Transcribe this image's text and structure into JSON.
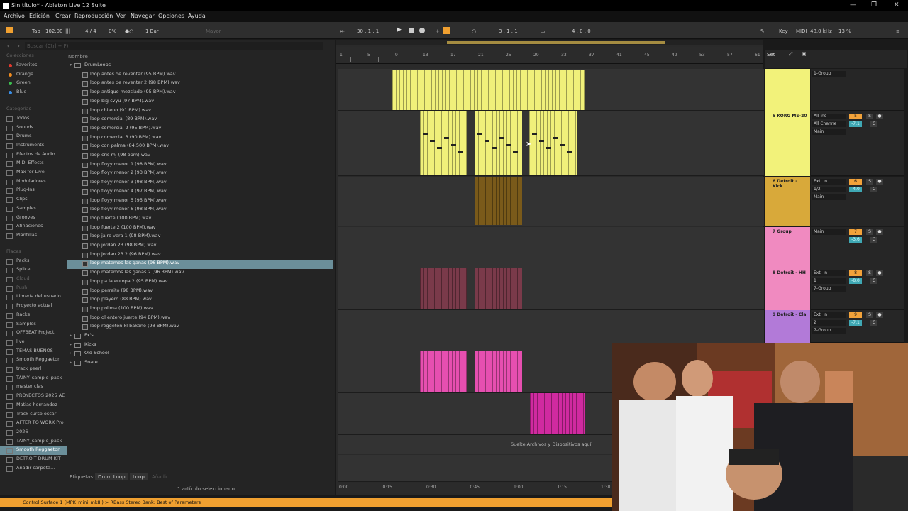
{
  "window": {
    "title": "Sin título* - Ableton Live 12 Suite"
  },
  "menu": [
    "Archivo",
    "Edición",
    "Crear",
    "Reproducción",
    "Ver",
    "Navegar",
    "Opciones",
    "Ayuda"
  ],
  "transport": {
    "tap": "Tap",
    "tempo": "102.00",
    "signature": "4 / 4",
    "percent": "0%",
    "quantize": "1 Bar",
    "key_text": "Mayor",
    "position": "30 .  1 .  1",
    "loop_start": "3 .  1 .  1",
    "loop_len": "4 .  0 .  0",
    "key_label": "Key",
    "midi_label": "MIDI",
    "sample_rate": "48.0 kHz",
    "cpu": "13 %"
  },
  "browser": {
    "search_placeholder": "Buscar (Ctrl + F)",
    "column_header": "Nombre",
    "collections_header": "Colecciones",
    "collections": [
      {
        "label": "Favoritos",
        "color": "#e23a2e"
      },
      {
        "label": "Orange",
        "color": "#f08b1f"
      },
      {
        "label": "Green",
        "color": "#3cbf4f"
      },
      {
        "label": "Blue",
        "color": "#3a8ee6"
      }
    ],
    "categories_header": "Categorías",
    "categories": [
      "Todos",
      "Sounds",
      "Drums",
      "Instruments",
      "Efectos de Audio",
      "MIDI Effects",
      "Max for Live",
      "Moduladores",
      "Plug-Ins",
      "Clips",
      "Samples",
      "Grooves",
      "Afinaciones",
      "Plantillas"
    ],
    "places_header": "Places",
    "places": [
      "Packs",
      "Splice",
      "Cloud",
      "Push",
      "Librería del usuario",
      "Proyecto actual",
      "Racks",
      "Samples",
      "OFFBEAT Project",
      "live",
      "TEMAS BUENOS",
      "Smooth Reggaeton",
      "track peerl",
      "TAINY_sample_pack",
      "master clas",
      "PROYECTOS 2025 AE",
      "Matias hernandez",
      "Track curso oscar",
      "AFTER TO WORK Pro",
      "2026",
      "TAINY_sample_pack",
      "Smooth Reggaeton",
      "DETROIT DRUM KIT",
      "Añadir carpeta..."
    ],
    "folder": "DrumLoops",
    "files": [
      "loop antes de reventar (95 BPM).wav",
      "loop antes de reventar 2 (98 BPM).wav",
      "loop antiguo mezclado (95 BPM).wav",
      "loop big cvyu (97 BPM).wav",
      "loop chileno (91 BPM).wav",
      "loop comercial (89 BPM).wav",
      "loop comercial 2 (95 BPM).wav",
      "loop comercial 3 (90 BPM).wav",
      "loop con palma (84.500 BPM).wav",
      "loop cris mj (98 bpm).wav",
      "loop floyy menor 1 (98 BPM).wav",
      "loop floyy menor 2 (93 BPM).wav",
      "loop floyy menor 3 (98 BPM).wav",
      "loop floyy menor 4 (97 BPM).wav",
      "loop floyy menor 5 (95 BPM).wav",
      "loop floyy menor 6 (98 BPM).wav",
      "loop fuerte (100 BPM).wav",
      "loop fuerte 2 (100 BPM).wav",
      "loop jairo vera 1 (98 BPM).wav",
      "loop jordan 23 (98 BPM).wav",
      "loop jordan 23 2 (96 BPM).wav",
      "loop matemos las ganas (96 BPM).wav",
      "loop matemos las ganas 2 (96 BPM).wav",
      "loop pa la europa 2 (95 BPM).wav",
      "loop perreito (98 BPM).wav",
      "loop playero (88 BPM).wav",
      "loop polima (100 BPM).wav",
      "loop ql entero juerte (94 BPM).wav",
      "loop reggeton kl bakano (98 BPM).wav"
    ],
    "subfolders": [
      "Fx's",
      "Kicks",
      "Old School",
      "Snare"
    ],
    "tags_label": "Etiquetas:",
    "tags": [
      "Drum Loop",
      "Loop"
    ],
    "add_tag": "Añadir",
    "selection_status": "1 artículo seleccionado"
  },
  "arrangement": {
    "bar_numbers": [
      "1",
      "5",
      "9",
      "13",
      "17",
      "21",
      "25",
      "29",
      "33",
      "37",
      "41",
      "45",
      "49",
      "53",
      "57",
      "61"
    ],
    "time_labels": [
      "0:00",
      "0:15",
      "0:30",
      "0:45",
      "1:00",
      "1:15",
      "1:30"
    ],
    "drop_hint": "Suelte Archivos y Dispositivos aquí",
    "set_label": "Set"
  },
  "tracks": [
    {
      "name": "",
      "color": "#f2f27a",
      "mix": [
        "1-Group"
      ]
    },
    {
      "name": "5 KORG MS-20",
      "color": "#f2f27a",
      "num": "5",
      "vol": "-7.1",
      "mix": [
        "All Ins",
        "All Channe",
        "Main"
      ]
    },
    {
      "name": "6 Detroit - Kick",
      "color": "#d8a93a",
      "num": "6",
      "vol": "-4.0",
      "mix": [
        "Ext. In",
        "1/2",
        "Main"
      ]
    },
    {
      "name": "7 Group",
      "color": "#f08ac0",
      "num": "7",
      "vol": "-3.6",
      "mix": [
        "Main"
      ]
    },
    {
      "name": "8 Detroit - HH",
      "color": "#f08ac0",
      "num": "8",
      "vol": "-8.0",
      "mix": [
        "Ext. In",
        "1",
        "7-Group"
      ]
    },
    {
      "name": "9 Detroit - Cla",
      "color": "#b27ad8",
      "num": "9",
      "vol": "-7.1",
      "mix": [
        "Ext. In",
        "2",
        "7-Group"
      ]
    }
  ],
  "status_bar": "Control Surface 1 (MPK_mini_mkIII) > RBass Stereo Bank: Best of Parameters"
}
